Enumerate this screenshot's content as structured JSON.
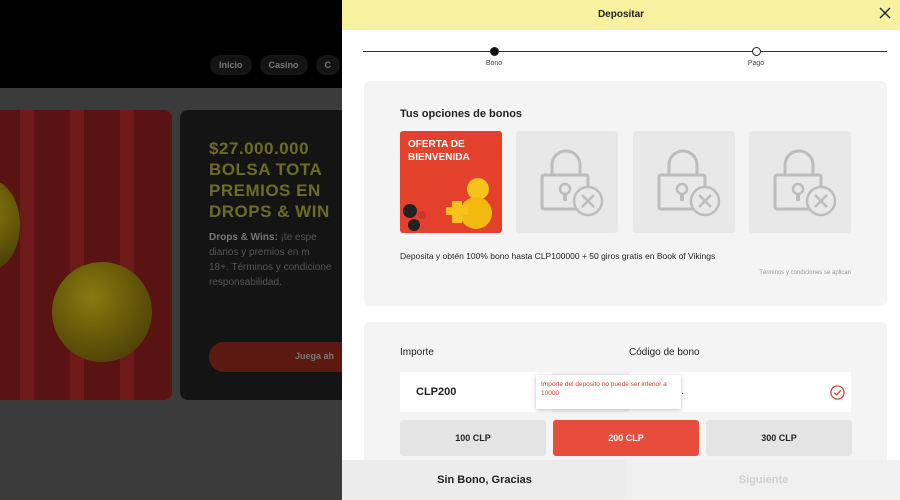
{
  "background": {
    "nav_items": [
      "Inicio",
      "Casino",
      "C"
    ],
    "promo": {
      "title": "$27.000.000\nBOLSA TOTA\nPREMIOS EN\nDROPS & WIN",
      "text_bold": "Drops & Wins:",
      "text": " ¡te espe\ndiarios y premios en m\n18+. Términos y condicione\nresponsabilidad.",
      "button_label": "Juega ah"
    }
  },
  "panel": {
    "title": "Depositar",
    "close_icon": "close-icon",
    "steps": [
      {
        "label": "Bono",
        "active": true
      },
      {
        "label": "Pago",
        "active": false
      }
    ],
    "bonus": {
      "heading": "Tus opciones de bonos",
      "offer_title": "OFERTA DE\nBIENVENIDA",
      "locked_icon": "lock-icon",
      "description": "Deposita y obtén 100% bono hasta CLP100000 + 50 giros gratis en Book of Vikings",
      "terms": "Términos y condiciones se aplican"
    },
    "form": {
      "amount_label": "Importe",
      "amount_value": "CLP200",
      "code_label": "Código de bono",
      "code_value": "...",
      "error_message": "Importe del depósito no puede ser inferior a 10000",
      "amount_buttons": [
        {
          "label": "100 CLP",
          "selected": false
        },
        {
          "label": "200 CLP",
          "selected": true
        },
        {
          "label": "300 CLP",
          "selected": false
        }
      ]
    },
    "footer": {
      "no_bonus_label": "Sin Bono, Gracias",
      "next_label": "Siguiente"
    }
  },
  "colors": {
    "header": "#f7f1a0",
    "accent_red": "#e84c3d",
    "error_text": "#d63b2e"
  }
}
